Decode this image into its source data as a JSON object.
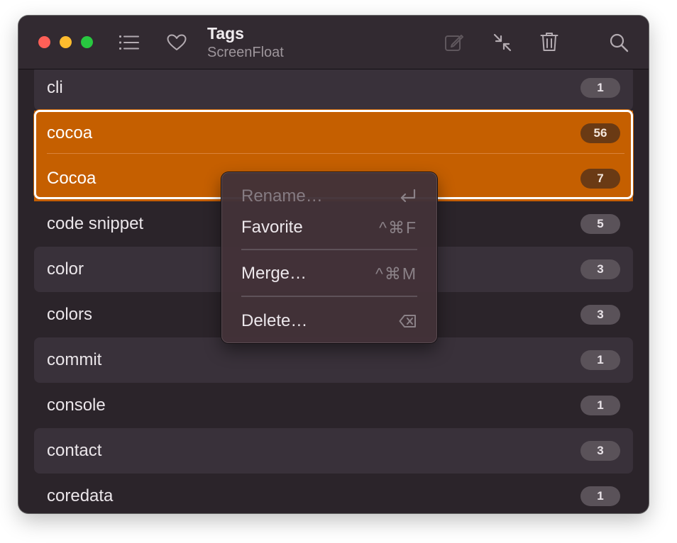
{
  "window": {
    "title": "Tags",
    "subtitle": "ScreenFloat"
  },
  "toolbar": {
    "icons": [
      "list-icon",
      "heart-icon",
      "edit-icon",
      "collapse-icon",
      "trash-icon",
      "search-icon"
    ]
  },
  "colors": {
    "selection": "#c55f00",
    "background": "#2b242a",
    "badge": "#5a5259"
  },
  "tags": [
    {
      "name": "cli",
      "count": "1"
    },
    {
      "name": "cocoa",
      "count": "56"
    },
    {
      "name": "Cocoa",
      "count": "7"
    },
    {
      "name": "code snippet",
      "count": "5"
    },
    {
      "name": "color",
      "count": "3"
    },
    {
      "name": "colors",
      "count": "3"
    },
    {
      "name": "commit",
      "count": "1"
    },
    {
      "name": "console",
      "count": "1"
    },
    {
      "name": "contact",
      "count": "3"
    },
    {
      "name": "coredata",
      "count": "1"
    }
  ],
  "context_menu": {
    "items": [
      {
        "label": "Rename…",
        "shortcut": "",
        "icon": "return-icon"
      },
      {
        "label": "Favorite",
        "shortcut": "^⌘F"
      },
      {
        "label": "Merge…",
        "shortcut": "^⌘M"
      },
      {
        "label": "Delete…",
        "shortcut": "",
        "icon": "delete-backward-icon"
      }
    ]
  }
}
